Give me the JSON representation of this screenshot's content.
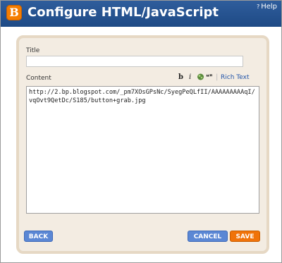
{
  "header": {
    "title": "Configure HTML/JavaScript",
    "help_label": "Help",
    "logo_letter": "B",
    "color": "#2a5896"
  },
  "form": {
    "title_label": "Title",
    "title_value": "",
    "content_label": "Content",
    "content_value": "http://2.bp.blogspot.com/_pm7XOsGPsNc/SyegPeQLfII/AAAAAAAAAqI/vqOvt9QetDc/S185/button+grab.jpg",
    "toolbar": {
      "bold": "b",
      "italic": "i",
      "link_icon": "leaf-icon",
      "quote": "❝❞",
      "rich_text": "Rich Text"
    }
  },
  "buttons": {
    "back": "BACK",
    "cancel": "CANCEL",
    "save": "SAVE",
    "blue": "#5b87d4",
    "orange": "#f0730a"
  }
}
